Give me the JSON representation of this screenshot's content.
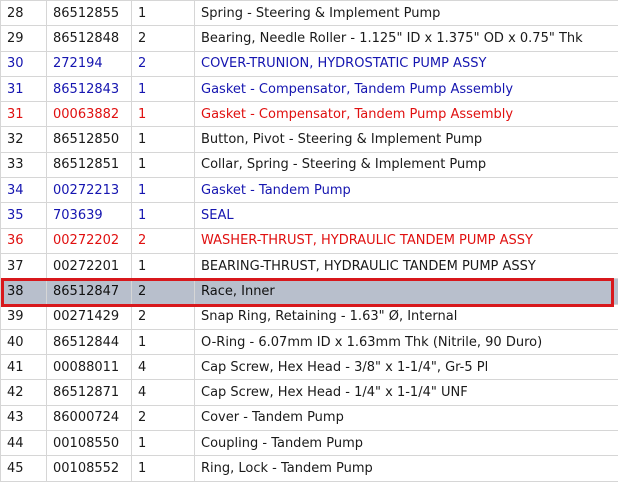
{
  "parts_table": {
    "rows": [
      {
        "ref": "28",
        "part": "86512855",
        "qty": "1",
        "desc": "Spring - Steering & Implement Pump",
        "color": "black"
      },
      {
        "ref": "29",
        "part": "86512848",
        "qty": "2",
        "desc": "Bearing, Needle Roller - 1.125\" ID x 1.375\" OD x 0.75\" Thk",
        "color": "black"
      },
      {
        "ref": "30",
        "part": "272194",
        "qty": "2",
        "desc": "COVER-TRUNION, HYDROSTATIC PUMP ASSY",
        "color": "blue"
      },
      {
        "ref": "31",
        "part": "86512843",
        "qty": "1",
        "desc": "Gasket - Compensator, Tandem Pump Assembly",
        "color": "blue"
      },
      {
        "ref": "31",
        "part": "00063882",
        "qty": "1",
        "desc": "Gasket - Compensator, Tandem Pump Assembly",
        "color": "red"
      },
      {
        "ref": "32",
        "part": "86512850",
        "qty": "1",
        "desc": "Button, Pivot - Steering & Implement Pump",
        "color": "black"
      },
      {
        "ref": "33",
        "part": "86512851",
        "qty": "1",
        "desc": "Collar, Spring - Steering & Implement Pump",
        "color": "black"
      },
      {
        "ref": "34",
        "part": "00272213",
        "qty": "1",
        "desc": "Gasket - Tandem Pump",
        "color": "blue"
      },
      {
        "ref": "35",
        "part": "703639",
        "qty": "1",
        "desc": "SEAL",
        "color": "blue"
      },
      {
        "ref": "36",
        "part": "00272202",
        "qty": "2",
        "desc": "WASHER-THRUST, HYDRAULIC TANDEM PUMP ASSY",
        "color": "red"
      },
      {
        "ref": "37",
        "part": "00272201",
        "qty": "1",
        "desc": "BEARING-THRUST, HYDRAULIC TANDEM PUMP ASSY",
        "color": "black"
      },
      {
        "ref": "38",
        "part": "86512847",
        "qty": "2",
        "desc": "Race, Inner",
        "color": "black",
        "selected": true
      },
      {
        "ref": "39",
        "part": "00271429",
        "qty": "2",
        "desc": "Snap Ring, Retaining - 1.63\" Ø, Internal",
        "color": "black"
      },
      {
        "ref": "40",
        "part": "86512844",
        "qty": "1",
        "desc": "O-Ring - 6.07mm ID x 1.63mm Thk (Nitrile, 90 Duro)",
        "color": "black"
      },
      {
        "ref": "41",
        "part": "00088011",
        "qty": "4",
        "desc": "Cap Screw, Hex Head - 3/8\" x 1-1/4\", Gr-5 Pl",
        "color": "black"
      },
      {
        "ref": "42",
        "part": "86512871",
        "qty": "4",
        "desc": "Cap Screw, Hex Head - 1/4\" x 1-1/4\" UNF",
        "color": "black"
      },
      {
        "ref": "43",
        "part": "86000724",
        "qty": "2",
        "desc": "Cover - Tandem Pump",
        "color": "black"
      },
      {
        "ref": "44",
        "part": "00108550",
        "qty": "1",
        "desc": "Coupling - Tandem Pump",
        "color": "black"
      },
      {
        "ref": "45",
        "part": "00108552",
        "qty": "1",
        "desc": "Ring, Lock - Tandem Pump",
        "color": "black"
      }
    ]
  },
  "colors": {
    "black": "#1a1a1a",
    "blue": "#1515b0",
    "red": "#e01010",
    "selection_fill": "#b8bfcc",
    "selection_border": "#d8181c"
  }
}
